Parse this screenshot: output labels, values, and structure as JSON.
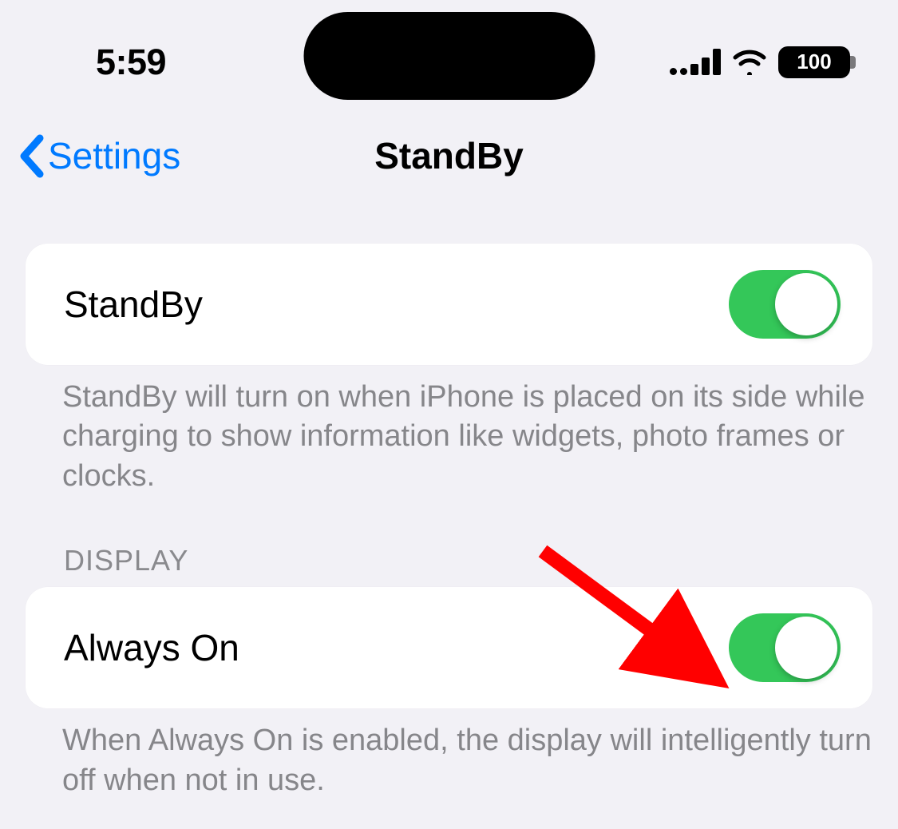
{
  "statusBar": {
    "time": "5:59",
    "battery": "100"
  },
  "nav": {
    "backLabel": "Settings",
    "title": "StandBy"
  },
  "rows": {
    "standby": {
      "label": "StandBy",
      "footer": "StandBy will turn on when iPhone is placed on its side while charging to show information like widgets, photo frames or clocks.",
      "on": true
    },
    "displaySectionHeader": "DISPLAY",
    "alwaysOn": {
      "label": "Always On",
      "footer": "When Always On is enabled, the display will intelligently turn off when not in use.",
      "on": true
    }
  },
  "colors": {
    "accent": "#007aff",
    "toggleOn": "#34c759",
    "annotation": "#ff0000"
  }
}
